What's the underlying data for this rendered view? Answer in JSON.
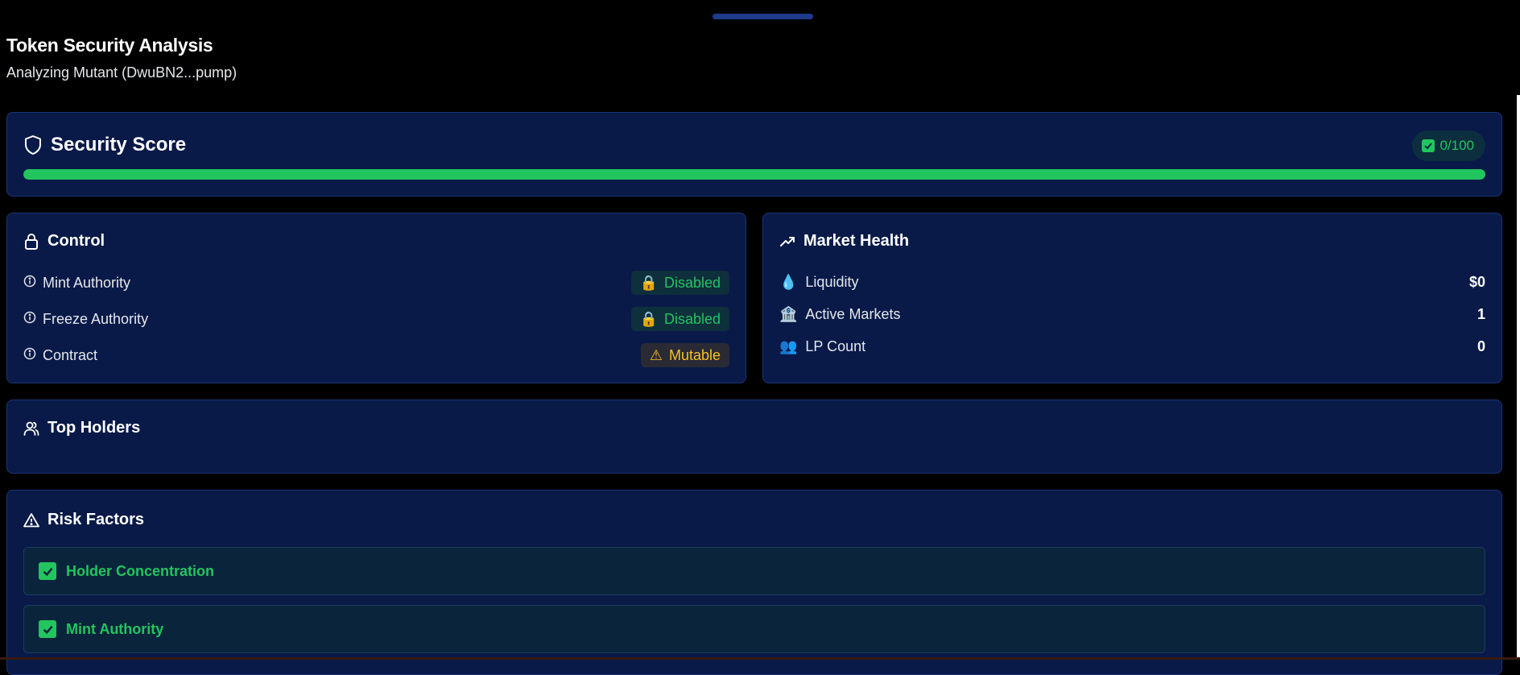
{
  "header": {
    "title": "Token Security Analysis",
    "subtitle": "Analyzing Mutant (DwuBN2...pump)"
  },
  "security_score": {
    "title": "Security Score",
    "score_label": "0/100",
    "progress_fraction": 1.0,
    "icon": "shield-icon",
    "accent_color": "#22c55e"
  },
  "control": {
    "title": "Control",
    "icon": "lock-icon",
    "rows": [
      {
        "label": "Mint Authority",
        "status": "Disabled",
        "status_icon": "🔒",
        "tone": "green"
      },
      {
        "label": "Freeze Authority",
        "status": "Disabled",
        "status_icon": "🔒",
        "tone": "green"
      },
      {
        "label": "Contract",
        "status": "Mutable",
        "status_icon": "⚠",
        "tone": "amber"
      }
    ]
  },
  "market_health": {
    "title": "Market Health",
    "icon": "trending-up-icon",
    "rows": [
      {
        "label": "Liquidity",
        "value": "$0",
        "emoji": "💧"
      },
      {
        "label": "Active Markets",
        "value": "1",
        "emoji": "🏦"
      },
      {
        "label": "LP Count",
        "value": "0",
        "emoji": "👥"
      }
    ]
  },
  "top_holders": {
    "title": "Top Holders",
    "icon": "users-icon"
  },
  "risk_factors": {
    "title": "Risk Factors",
    "icon": "warning-icon",
    "items": [
      {
        "label": "Holder Concentration"
      },
      {
        "label": "Mint Authority"
      }
    ]
  }
}
